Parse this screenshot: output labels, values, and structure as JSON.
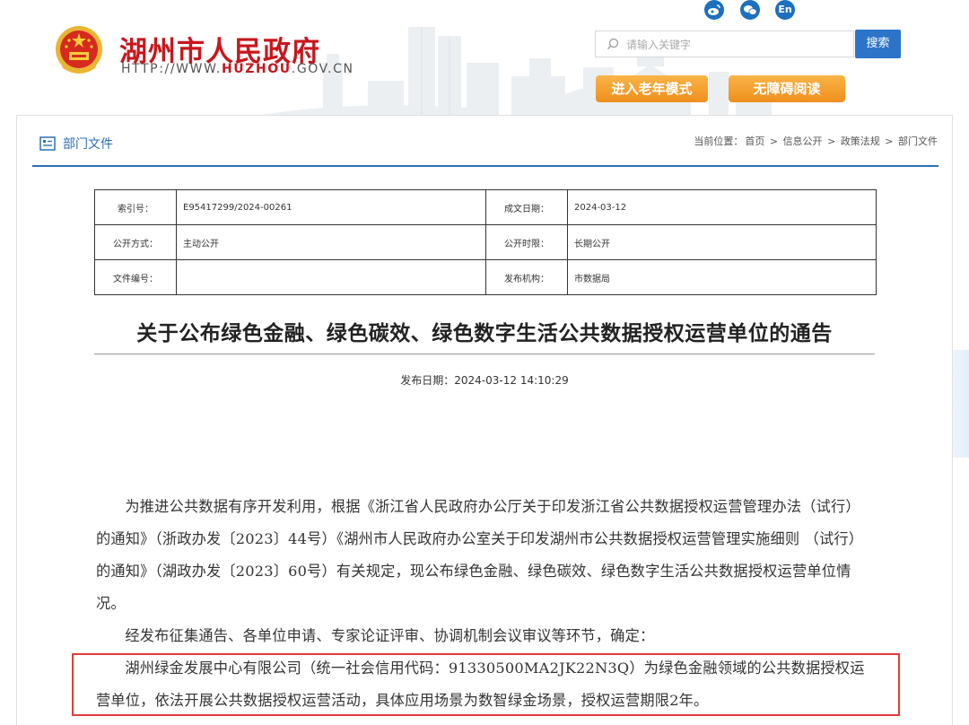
{
  "header": {
    "site_name": "湖州市人民政府",
    "site_url_prefix": "HTTP://WWW.",
    "site_url_domain": "HUZHOU",
    "site_url_suffix": ".GOV.CN",
    "social": [
      {
        "icon": "weibo-icon",
        "label": ""
      },
      {
        "icon": "wechat-icon",
        "label": ""
      },
      {
        "icon": "english-icon",
        "label": "En"
      }
    ],
    "search_placeholder": "请输入关键字",
    "search_button": "搜索",
    "elder_mode": "进入老年模式",
    "accessible_mode": "无障碍阅读",
    "colors": {
      "brand_red": "#c8161d",
      "accent_blue": "#2b74c8",
      "orange": "#f3a233"
    }
  },
  "section": {
    "title": "部门文件",
    "breadcrumb_prefix": "当前位置：",
    "breadcrumb": [
      "首页",
      "信息公开",
      "政策法规",
      "部门文件"
    ],
    "separator": ">"
  },
  "meta": {
    "index_label": "索引号：",
    "index_value": "E95417299/2024-00261",
    "date_label": "成文日期：",
    "date_value": "2024-03-12",
    "mode_label": "公开方式：",
    "mode_value": "主动公开",
    "period_label": "公开时限：",
    "period_value": "长期公开",
    "doc_no_label": "文件编号：",
    "doc_no_value": "",
    "publisher_label": "发布机构：",
    "publisher_value": "市数据局"
  },
  "article": {
    "title": "关于公布绿色金融、绿色碳效、绿色数字生活公共数据授权运营单位的通告",
    "publish_label": "发布日期：",
    "publish_value": "2024-03-12 14:10:29",
    "paragraphs": [
      "为推进公共数据有序开发利用，根据《浙江省人民政府办公厅关于印发浙江省公共数据授权运营管理办法（试行）的通知》（浙政办发〔2023〕44号）《湖州市人民政府办公室关于印发湖州市公共数据授权运营管理实施细则 （试行）的通知》（湖政办发〔2023〕60号）有关规定，现公布绿色金融、绿色碳效、绿色数字生活公共数据授权运营单位情况。",
      "经发布征集通告、各单位申请、专家论证评审、协调机制会议审议等环节，确定：",
      "湖州绿金发展中心有限公司（统一社会信用代码：91330500MA2JK22N3Q）为绿色金融领域的公共数据授权运营单位，依法开展公共数据授权运营活动，具体应用场景为数智绿金场景，授权运营期限2年。"
    ]
  }
}
